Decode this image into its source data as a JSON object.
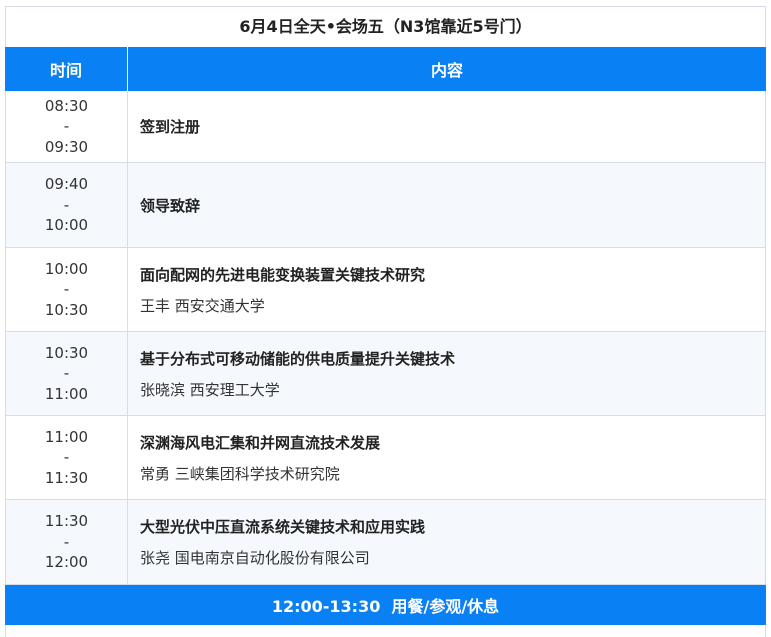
{
  "title": "6月4日全天•会场五（N3馆靠近5号门）",
  "header": {
    "time": "时间",
    "content": "内容"
  },
  "rows": [
    {
      "start": "08:30",
      "sep": "-",
      "end": "09:30",
      "topic": "签到注册",
      "speaker": ""
    },
    {
      "start": "09:40",
      "sep": "-",
      "end": "10:00",
      "topic": "领导致辞",
      "speaker": ""
    },
    {
      "start": "10:00",
      "sep": "-",
      "end": "10:30",
      "topic": "面向配网的先进电能变换装置关键技术研究",
      "speaker": "王丰 西安交通大学"
    },
    {
      "start": "10:30",
      "sep": "-",
      "end": "11:00",
      "topic": "基于分布式可移动储能的供电质量提升关键技术",
      "speaker": "张晓滨 西安理工大学"
    },
    {
      "start": "11:00",
      "sep": "-",
      "end": "11:30",
      "topic": "深渊海风电汇集和并网直流技术发展",
      "speaker": "常勇 三峡集团科学技术研究院"
    },
    {
      "start": "11:30",
      "sep": "-",
      "end": "12:00",
      "topic": "大型光伏中压直流系统关键技术和应用实践",
      "speaker": "张尧 国电南京自动化股份有限公司"
    }
  ],
  "banner": "12:00-13:30  用餐/参观/休息",
  "colors": {
    "accent": "#0a80f5",
    "alt_row": "#f5f9fd",
    "border": "#d6dde6"
  }
}
